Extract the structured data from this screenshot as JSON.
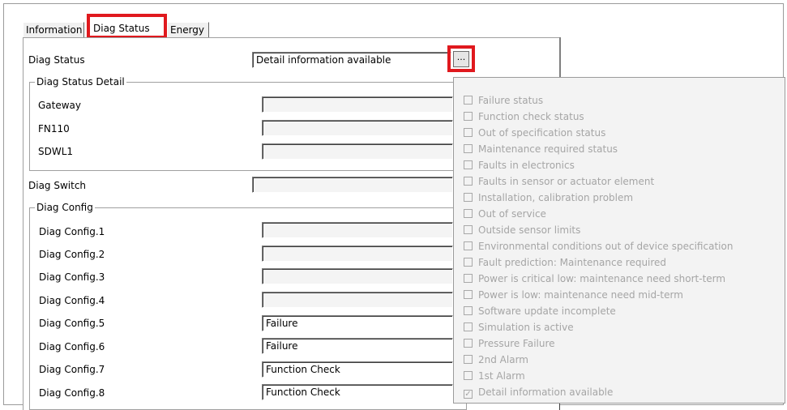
{
  "tabs": [
    {
      "label": "Information"
    },
    {
      "label": "Diag Status"
    },
    {
      "label": "Energy"
    }
  ],
  "diag_status": {
    "label": "Diag Status",
    "value": "Detail information available",
    "button_label": "..."
  },
  "diag_status_detail": {
    "title": "Diag Status Detail",
    "rows": [
      {
        "label": "Gateway",
        "value": ""
      },
      {
        "label": "FN110",
        "value": ""
      },
      {
        "label": "SDWL1",
        "value": ""
      }
    ]
  },
  "diag_switch": {
    "label": "Diag Switch",
    "value": ""
  },
  "diag_config": {
    "title": "Diag Config",
    "rows": [
      {
        "label": "Diag Config.1",
        "value": ""
      },
      {
        "label": "Diag Config.2",
        "value": ""
      },
      {
        "label": "Diag Config.3",
        "value": ""
      },
      {
        "label": "Diag Config.4",
        "value": ""
      },
      {
        "label": "Diag Config.5",
        "value": "Failure"
      },
      {
        "label": "Diag Config.6",
        "value": "Failure"
      },
      {
        "label": "Diag Config.7",
        "value": "Function Check"
      },
      {
        "label": "Diag Config.8",
        "value": "Function Check"
      }
    ]
  },
  "detail_list": [
    {
      "label": "Failure status",
      "checked": false
    },
    {
      "label": "Function check status",
      "checked": false
    },
    {
      "label": "Out of specification status",
      "checked": false
    },
    {
      "label": "Maintenance required status",
      "checked": false
    },
    {
      "label": "Faults in electronics",
      "checked": false
    },
    {
      "label": "Faults in sensor or actuator element",
      "checked": false
    },
    {
      "label": "Installation, calibration problem",
      "checked": false
    },
    {
      "label": "Out of service",
      "checked": false
    },
    {
      "label": "Outside sensor limits",
      "checked": false
    },
    {
      "label": "Environmental conditions out of device specification",
      "checked": false
    },
    {
      "label": "Fault prediction: Maintenance required",
      "checked": false
    },
    {
      "label": "Power is critical low: maintenance need short-term",
      "checked": false
    },
    {
      "label": "Power is low: maintenance need mid-term",
      "checked": false
    },
    {
      "label": "Software update incomplete",
      "checked": false
    },
    {
      "label": "Simulation is active",
      "checked": false
    },
    {
      "label": "Pressure Failure",
      "checked": false
    },
    {
      "label": "2nd Alarm",
      "checked": false
    },
    {
      "label": "1st Alarm",
      "checked": false
    },
    {
      "label": "Detail information available",
      "checked": true
    }
  ],
  "highlight_color": "#e0191e"
}
